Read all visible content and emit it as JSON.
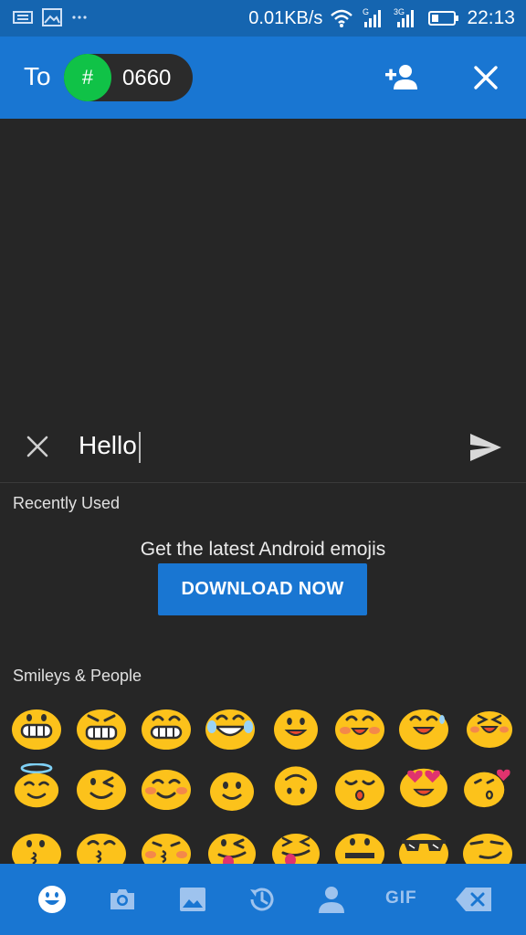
{
  "status_bar": {
    "speed": "0.01KB/s",
    "time": "22:13",
    "sim1_label": "G",
    "sim2_label": "3G"
  },
  "header": {
    "to_label": "To",
    "chip_avatar": "#",
    "chip_text": "0660"
  },
  "compose": {
    "text": "Hello"
  },
  "emoji_panel": {
    "recent_title": "Recently Used",
    "promo_text": "Get the latest Android emojis",
    "download_label": "DOWNLOAD NOW",
    "section_title": "Smileys & People"
  },
  "bottom_bar": {
    "gif_label": "GIF"
  },
  "colors": {
    "status_bar": "#1565b0",
    "header": "#1976d2",
    "background": "#262626",
    "chip_avatar": "#10c247",
    "emoji_yellow": "#fcc21b"
  }
}
